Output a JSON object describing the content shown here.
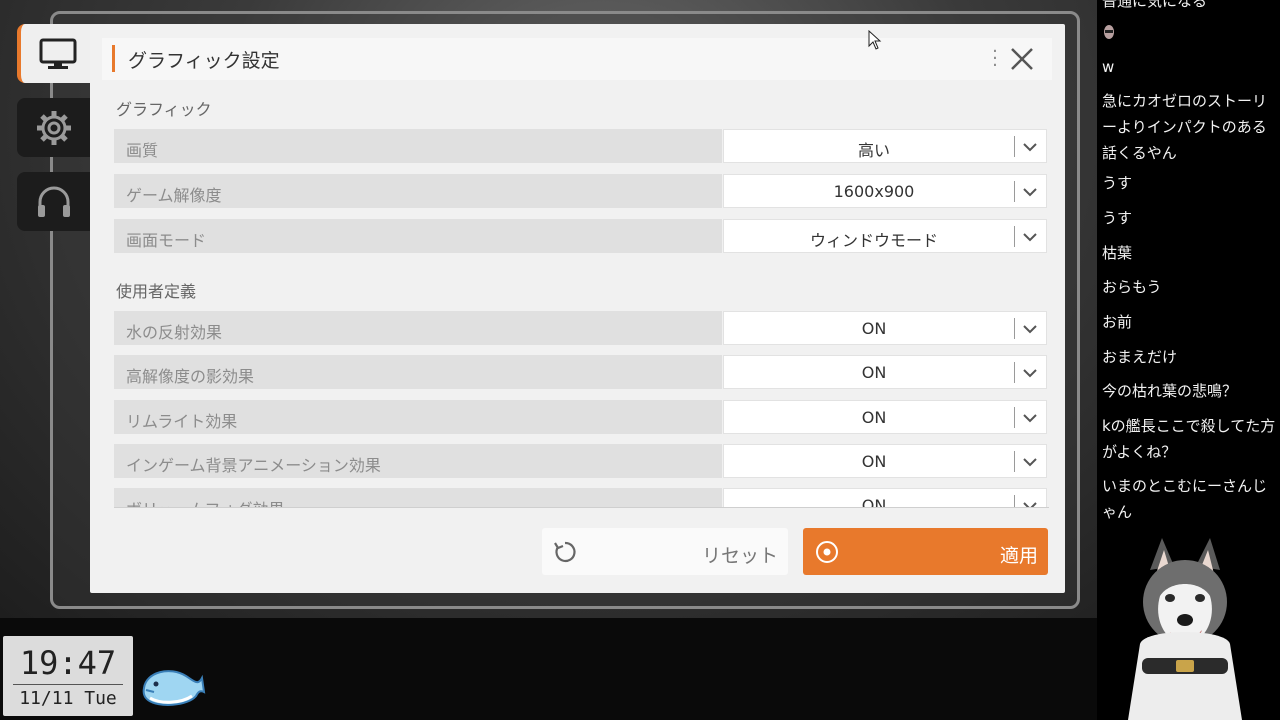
{
  "panel": {
    "title": "グラフィック設定",
    "sections": [
      {
        "title": "グラフィック"
      },
      {
        "title": "使用者定義"
      }
    ],
    "settings": [
      {
        "label": "画質",
        "value": "高い"
      },
      {
        "label": "ゲーム解像度",
        "value": "1600x900"
      },
      {
        "label": "画面モード",
        "value": "ウィンドウモード"
      },
      {
        "label": "水の反射効果",
        "value": "ON"
      },
      {
        "label": "高解像度の影効果",
        "value": "ON"
      },
      {
        "label": "リムライト効果",
        "value": "ON"
      },
      {
        "label": "インゲーム背景アニメーション効果",
        "value": "ON"
      },
      {
        "label": "ボリュームフォグ効果",
        "value": "ON"
      }
    ],
    "reset_label": "リセット",
    "apply_label": "適用",
    "accent_color": "#e8792c"
  },
  "side_tabs": [
    {
      "icon": "monitor-icon",
      "active": true
    },
    {
      "icon": "gear-icon",
      "active": false
    },
    {
      "icon": "headphones-icon",
      "active": false
    }
  ],
  "clock": {
    "time": "19:47",
    "date": "11/11 Tue"
  },
  "chat": {
    "messages": [
      "普通に気になる",
      "w",
      "急にカオゼロのストーリーよりインパクトのある話くるやん",
      "うす",
      "うす",
      "枯葉",
      "おらもう",
      "お前",
      "おまえだけ",
      "今の枯れ葉の悲鳴？",
      "kの艦長ここで殺してた方がよくね？",
      "いまのとこむにーさんじゃん"
    ]
  }
}
